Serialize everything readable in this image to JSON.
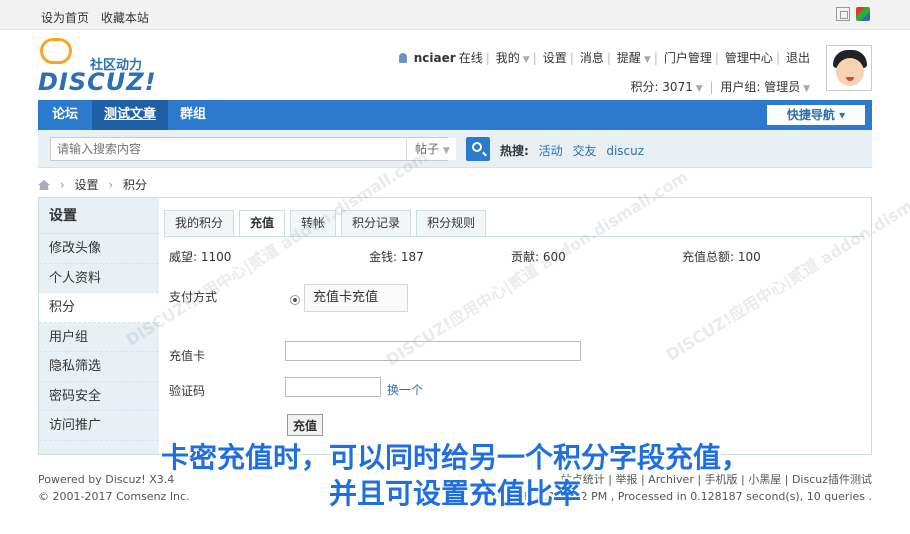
{
  "topbar": {
    "set_homepage": "设为首页",
    "bookmark": "收藏本站",
    "tools": [
      "fullscreen-icon",
      "color-icon"
    ]
  },
  "header": {
    "logo_tagline": "社区动力",
    "logo_text": "DISCUZ!",
    "username": "nciaer",
    "online": "在线",
    "menu": [
      "我的",
      "设置",
      "消息",
      "提醒",
      "门户管理",
      "管理中心",
      "退出"
    ],
    "credits": "积分: 3071",
    "usergroup": "用户组: 管理员"
  },
  "nav": {
    "items": [
      "论坛",
      "测试文章",
      "群组"
    ],
    "active_index": 1,
    "quick_nav": "快捷导航"
  },
  "search": {
    "placeholder": "请输入搜索内容",
    "scope": "帖子",
    "hot_label": "热搜:",
    "hot_terms": [
      "活动",
      "交友",
      "discuz"
    ]
  },
  "breadcrumb": [
    "设置",
    "积分"
  ],
  "sidebar": {
    "title": "设置",
    "items": [
      "修改头像",
      "个人资料",
      "积分",
      "用户组",
      "隐私筛选",
      "密码安全",
      "访问推广"
    ],
    "active_index": 2
  },
  "tabs": {
    "items": [
      "我的积分",
      "充值",
      "转帐",
      "积分记录",
      "积分规则"
    ],
    "active_index": 1
  },
  "stats": {
    "prestige": "威望: 1100",
    "money": "金钱: 187",
    "contribution": "贡献: 600",
    "recharge_total": "充值总额: 100"
  },
  "form": {
    "payment_label": "支付方式",
    "payment_option": "充值卡充值",
    "card_label": "充值卡",
    "captcha_label": "验证码",
    "refresh_captcha": "换一个",
    "submit": "充值"
  },
  "footer": {
    "powered_by": "Powered by Discuz! X3.4",
    "copyright": "© 2001-2017 Comsenz Inc.",
    "links": "站点统计 | 举报 | Archiver | 手机版 | 小黑屋 | Discuz插件测试",
    "timing": "GMT+8, 2017-... 2 PM , Processed in 0.128187 second(s), 10 queries ."
  },
  "watermark": "DISCUZ!应用中心|贰道 addon.dismall.com",
  "caption": {
    "line1": "卡密充值时，可以同时给另一个积分字段充值，",
    "line2": "并且可设置充值比率"
  }
}
